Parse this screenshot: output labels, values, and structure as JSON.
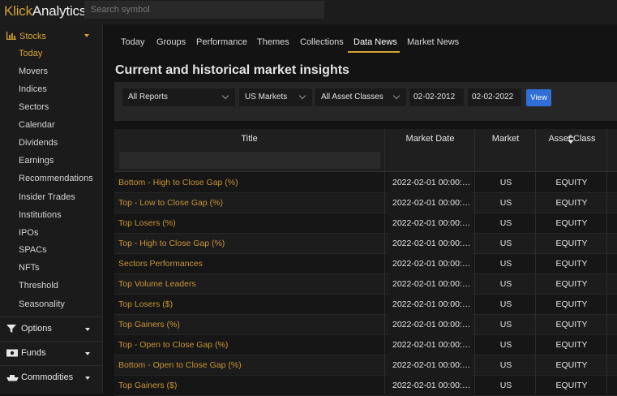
{
  "app": {
    "logo_part1": "Klick",
    "logo_part2": "Analytics"
  },
  "search": {
    "placeholder": "Search symbol"
  },
  "sidebar": {
    "section": {
      "label": "Stocks",
      "icon": "bar-chart-icon"
    },
    "items": [
      {
        "label": "Today",
        "active": true
      },
      {
        "label": "Movers"
      },
      {
        "label": "Indices"
      },
      {
        "label": "Sectors"
      },
      {
        "label": "Calendar"
      },
      {
        "label": "Dividends"
      },
      {
        "label": "Earnings"
      },
      {
        "label": "Recommendations"
      },
      {
        "label": "Insider Trades"
      },
      {
        "label": "Institutions"
      },
      {
        "label": "IPOs"
      },
      {
        "label": "SPACs"
      },
      {
        "label": "NFTs"
      },
      {
        "label": "Threshold"
      },
      {
        "label": "Seasonality"
      }
    ],
    "groups": [
      {
        "label": "Options",
        "icon": "filter-icon"
      },
      {
        "label": "Funds",
        "icon": "money-icon"
      },
      {
        "label": "Commodities",
        "icon": "ship-icon"
      }
    ]
  },
  "tabs": [
    {
      "label": "Today"
    },
    {
      "label": "Groups"
    },
    {
      "label": "Performance"
    },
    {
      "label": "Themes"
    },
    {
      "label": "Collections"
    },
    {
      "label": "Data News",
      "active": true
    },
    {
      "label": "Market News"
    }
  ],
  "main": {
    "title": "Current and historical market insights"
  },
  "filters": {
    "report": "All Reports",
    "market": "US Markets",
    "asset_class": "All Asset Classes",
    "date_from": "02-02-2012",
    "date_to": "02-02-2022",
    "view_label": "View"
  },
  "table": {
    "columns": [
      "Title",
      "Market Date",
      "Market",
      "Asset Class"
    ],
    "rows": [
      {
        "title": "Bottom - High to Close Gap (%)",
        "date": "2022-02-01 00:00:00...",
        "market": "US",
        "asset": "EQUITY"
      },
      {
        "title": "Top - Low to Close Gap (%)",
        "date": "2022-02-01 00:00:00...",
        "market": "US",
        "asset": "EQUITY"
      },
      {
        "title": "Top Losers (%)",
        "date": "2022-02-01 00:00:00...",
        "market": "US",
        "asset": "EQUITY"
      },
      {
        "title": "Top - High to Close Gap (%)",
        "date": "2022-02-01 00:00:00...",
        "market": "US",
        "asset": "EQUITY"
      },
      {
        "title": "Sectors Performances",
        "date": "2022-02-01 00:00:00...",
        "market": "US",
        "asset": "EQUITY"
      },
      {
        "title": "Top Volume Leaders",
        "date": "2022-02-01 00:00:00...",
        "market": "US",
        "asset": "EQUITY"
      },
      {
        "title": "Top Losers ($)",
        "date": "2022-02-01 00:00:00...",
        "market": "US",
        "asset": "EQUITY"
      },
      {
        "title": "Top Gainers (%)",
        "date": "2022-02-01 00:00:00...",
        "market": "US",
        "asset": "EQUITY"
      },
      {
        "title": "Top - Open to Close Gap (%)",
        "date": "2022-02-01 00:00:00...",
        "market": "US",
        "asset": "EQUITY"
      },
      {
        "title": "Bottom - Open to Close Gap (%)",
        "date": "2022-02-01 00:00:00...",
        "market": "US",
        "asset": "EQUITY"
      },
      {
        "title": "Top Gainers ($)",
        "date": "2022-02-01 00:00:00...",
        "market": "US",
        "asset": "EQUITY"
      }
    ]
  },
  "colors": {
    "accent": "#d4a233",
    "button": "#2f6fd6",
    "link": "#c79433"
  }
}
